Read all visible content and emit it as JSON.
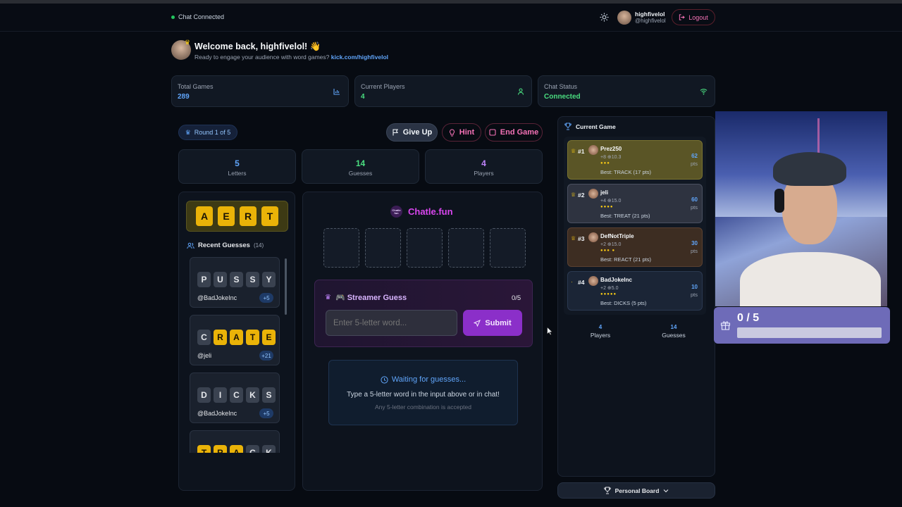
{
  "header": {
    "chat_status": "Chat Connected",
    "display_name": "highfivelol",
    "handle": "@highfivelol",
    "logout_label": "Logout"
  },
  "welcome": {
    "title": "Welcome back, highfivelol! 👋",
    "subtitle": "Ready to engage your audience with word games?",
    "link": "kick.com/highfivelol"
  },
  "stats": [
    {
      "label": "Total Games",
      "value": "289"
    },
    {
      "label": "Current Players",
      "value": "4"
    },
    {
      "label": "Chat Status",
      "value": "Connected"
    }
  ],
  "game": {
    "round_label": "Round 1 of 5",
    "actions": {
      "give_up": "Give Up",
      "hint": "Hint",
      "end_game": "End Game"
    },
    "counters": [
      {
        "value": "5",
        "label": "Letters",
        "color": "#60a5fa"
      },
      {
        "value": "14",
        "label": "Guesses",
        "color": "#4ade80"
      },
      {
        "value": "4",
        "label": "Players",
        "color": "#c084fc"
      }
    ],
    "revealed": [
      "A",
      "E",
      "R",
      "T"
    ],
    "recent_title": "Recent Guesses",
    "recent_count": "(14)",
    "recent": [
      {
        "letters": [
          "P",
          "U",
          "S",
          "S",
          "Y"
        ],
        "yellow": [],
        "user": "@BadJokeInc",
        "pts": "+5"
      },
      {
        "letters": [
          "C",
          "R",
          "A",
          "T",
          "E"
        ],
        "yellow": [
          1,
          2,
          3,
          4
        ],
        "user": "@jeli",
        "pts": "+21"
      },
      {
        "letters": [
          "D",
          "I",
          "C",
          "K",
          "S"
        ],
        "yellow": [],
        "user": "@BadJokeInc",
        "pts": "+5"
      },
      {
        "letters": [
          "T",
          "R",
          "A",
          "C",
          "K"
        ],
        "yellow": [
          0,
          1,
          2
        ],
        "user": "",
        "pts": ""
      }
    ],
    "brand": "Chatle.fun",
    "brand_badge": "Chatle fun",
    "streamer_title": "🎮 Streamer Guess",
    "streamer_count": "0/5",
    "input_placeholder": "Enter 5-letter word...",
    "submit_label": "Submit",
    "waiting_title": "Waiting for guesses...",
    "waiting_line1": "Type a 5-letter word in the input above or in chat!",
    "waiting_line2": "Any 5-letter combination is accepted"
  },
  "leaderboard": {
    "title": "Current Game",
    "players": [
      {
        "rank": "#1",
        "name": "Prez250",
        "meta": "+8 ⊕10.3",
        "best": "Best: TRACK (17 pts)",
        "pts": "62",
        "unit": "pts",
        "dots": "●●●",
        "bg": "#5a5526",
        "border": "#7a7330"
      },
      {
        "rank": "#2",
        "name": "jeli",
        "meta": "+4 ⊕15.0",
        "best": "Best: TREAT (21 pts)",
        "pts": "60",
        "unit": "pts",
        "dots": "●●●●",
        "bg": "#2e3340",
        "border": "#4a5060"
      },
      {
        "rank": "#3",
        "name": "DefNotTriple",
        "meta": "+2 ⊕15.0",
        "best": "Best: REACT (21 pts)",
        "pts": "30",
        "unit": "pts",
        "dots": "●●● ●",
        "bg": "#3d2d22",
        "border": "#5b4130"
      },
      {
        "rank": "#4",
        "name": "BadJokeInc",
        "meta": "+2 ⊕5.0",
        "best": "Best: DICKS (5 pts)",
        "pts": "10",
        "unit": "pts",
        "dots": "●●●●●",
        "bg": "#1b2536",
        "border": "#2b3950"
      }
    ],
    "footer": [
      {
        "value": "4",
        "label": "Players"
      },
      {
        "value": "14",
        "label": "Guesses"
      }
    ],
    "personal_board": "Personal Board"
  },
  "overlay": {
    "progress": "0 / 5",
    "progress_fraction": 0
  }
}
